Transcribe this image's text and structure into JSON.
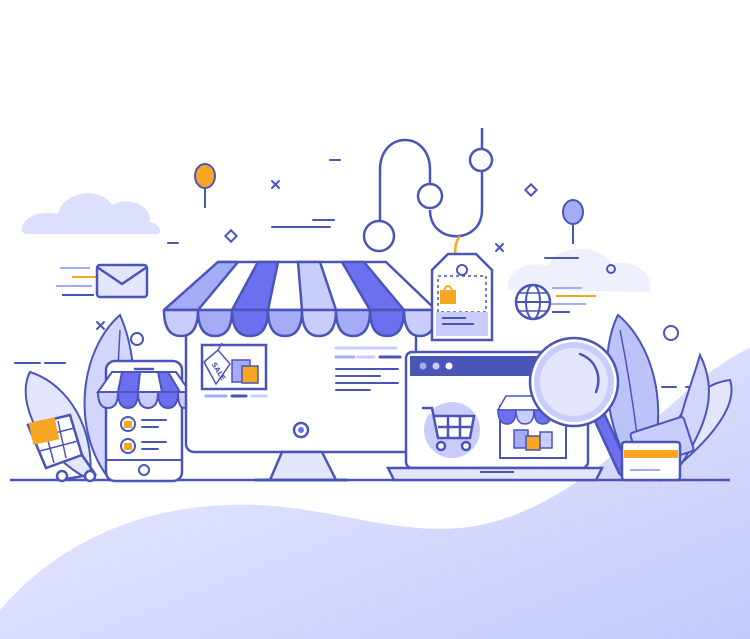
{
  "illustration": {
    "sale_tag_label": "SALE"
  },
  "colors": {
    "line": "#4a55b8",
    "accent": "#6b6ff0",
    "light": "#c9cdfc",
    "pale": "#e4e6fd",
    "fill": "#ffffff",
    "highlight": "#f6a623",
    "blob": "#cfd3fb"
  },
  "icons": [
    "storefront-icon",
    "awning-icon",
    "price-tag-icon",
    "shopping-bag-icon",
    "envelope-icon",
    "globe-icon",
    "magnifier-icon",
    "shopping-cart-icon",
    "laptop-icon",
    "smartphone-icon",
    "credit-card-icon",
    "balloon-icon",
    "leaf-icon",
    "gift-icon"
  ]
}
